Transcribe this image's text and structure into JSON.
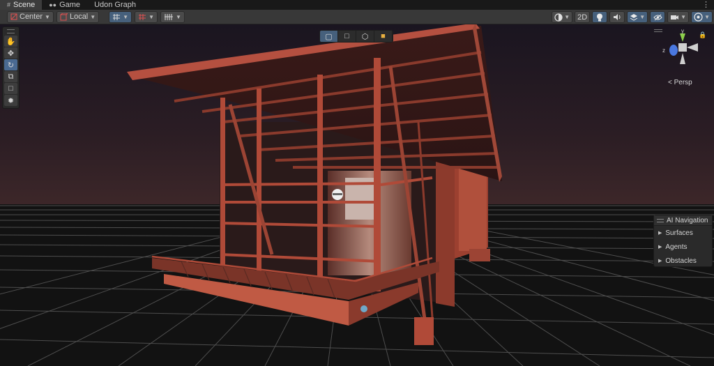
{
  "tabs": [
    {
      "label": "Scene",
      "icon": "grid-icon",
      "active": true
    },
    {
      "label": "Game",
      "icon": "gamepad-icon",
      "active": false
    },
    {
      "label": "Udon Graph",
      "icon": "",
      "active": false
    }
  ],
  "toolbar": {
    "pivot_label": "Center",
    "space_label": "Local",
    "mode_2d_label": "2D"
  },
  "tool_palette": [
    "hand-tool",
    "move-tool",
    "rotate-tool",
    "scale-tool",
    "rect-tool",
    "transform-tool"
  ],
  "active_tool": "rotate-tool",
  "gizmo": {
    "y_axis_label": "y",
    "z_axis_label": "z",
    "projection_label": "< Persp"
  },
  "ai_navigation": {
    "title": "AI Navigation",
    "items": [
      "Surfaces",
      "Agents",
      "Obstacles"
    ]
  },
  "colors": {
    "toolbar_bg": "#383838",
    "tab_active": "#3c3c3c",
    "accent_blue": "#46607c",
    "sky_top": "#1c1622",
    "sky_horizon": "#3a2628",
    "ground": "#111111",
    "grid": "#5a5a5a",
    "building": "#a04a3a",
    "building_shadow": "#5a2a22"
  }
}
